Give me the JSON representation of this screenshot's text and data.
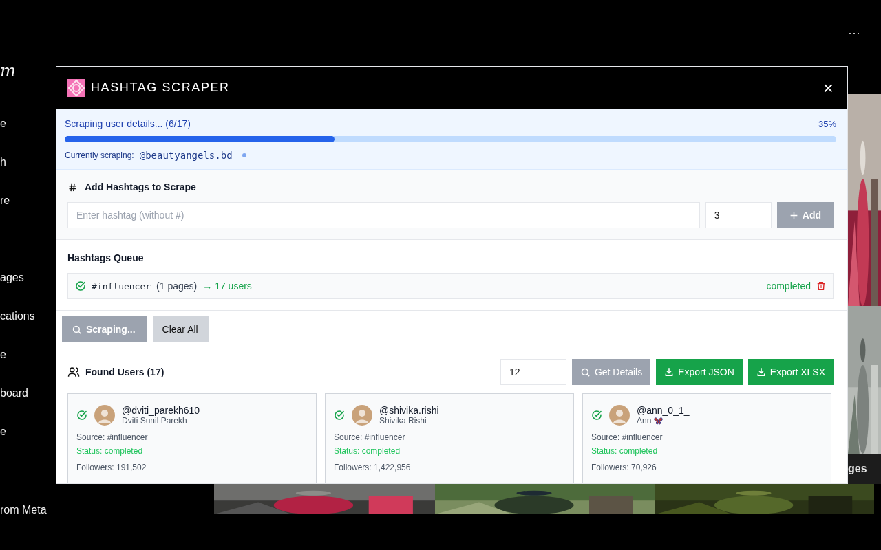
{
  "background": {
    "logo": "m",
    "sidebar_items": [
      "e",
      "h",
      "re",
      "ages",
      "cations",
      "e",
      "board",
      "e"
    ],
    "sidebar_footer": "rom Meta",
    "more_menu": "···",
    "overlay_label": "ges"
  },
  "window": {
    "title": "HASHTAG SCRAPER",
    "close": "×"
  },
  "progress": {
    "label": "Scraping user details... (6/17)",
    "percent": "35%",
    "level": 0.35,
    "current_label": "Currently scraping:",
    "current_user": "@beautyangels.bd"
  },
  "add_section": {
    "title": "Add Hashtags to Scrape",
    "hashtag_placeholder": "Enter hashtag (without #)",
    "pages_value": "3",
    "add_button": {
      "label": "Add",
      "disabled": true
    }
  },
  "queue": {
    "title": "Hashtags Queue",
    "items": [
      {
        "tag": "#influencer",
        "pages": "(1 pages)",
        "users": "→ 17 users",
        "status": "completed",
        "done": true
      }
    ]
  },
  "actions": [
    {
      "label": "Scraping...",
      "kind": "scrape",
      "disabled": true
    },
    {
      "label": "Clear All",
      "kind": "clear",
      "disabled": false
    }
  ],
  "found_users": {
    "title": "Found Users (17)",
    "count_value": "12",
    "buttons": [
      {
        "label": "Get Details",
        "kind": "details",
        "disabled": true
      },
      {
        "label": "Export JSON",
        "kind": "export",
        "disabled": false
      },
      {
        "label": "Export XLSX",
        "kind": "export",
        "disabled": false
      }
    ],
    "users": [
      {
        "handle": "@dviti_parekh610",
        "name": "Dviti Sunil Parekh",
        "butterfly": false,
        "source": "Source: #influencer",
        "status": "Status: completed",
        "done": true,
        "followers": "Followers: 191,502"
      },
      {
        "handle": "@shivika.rishi",
        "name": "Shivika Rishi",
        "butterfly": false,
        "source": "Source: #influencer",
        "status": "Status: completed",
        "done": true,
        "followers": "Followers: 1,422,956"
      },
      {
        "handle": "@ann_0_1_",
        "name": "Ann",
        "butterfly": true,
        "source": "Source: #influencer",
        "status": "Status: completed",
        "done": true,
        "followers": "Followers: 70,926"
      }
    ]
  }
}
